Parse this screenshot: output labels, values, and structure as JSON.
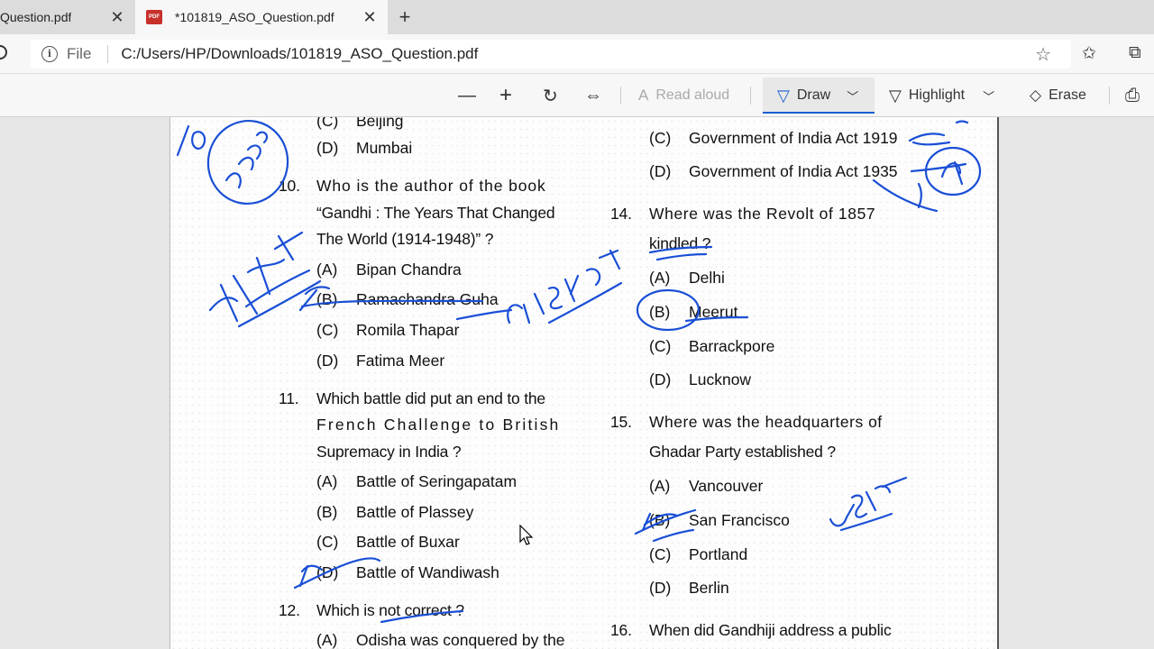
{
  "browser": {
    "tabs": [
      {
        "label": "Question.pdf",
        "active": false
      },
      {
        "label": "*101819_ASO_Question.pdf",
        "active": true
      }
    ],
    "address": {
      "scheme_label": "File",
      "url": "C:/Users/HP/Downloads/101819_ASO_Question.pdf"
    }
  },
  "toolbar": {
    "read_aloud": "Read aloud",
    "draw": "Draw",
    "highlight": "Highlight",
    "erase": "Erase"
  },
  "colors": {
    "ink": "#1a4fd6",
    "accent": "#1a5fd0"
  },
  "document": {
    "left_column": {
      "q9_tail": [
        {
          "letter": "(C)",
          "text": "Beijing"
        },
        {
          "letter": "(D)",
          "text": "Mumbai"
        }
      ],
      "q10": {
        "number": "10.",
        "lines": [
          "Who is the author of the book",
          "“Gandhi : The Years That Changed",
          "The World (1914-1948)” ?"
        ],
        "options": [
          {
            "letter": "(A)",
            "text": "Bipan Chandra"
          },
          {
            "letter": "(B)",
            "text": "Ramachandra Guha"
          },
          {
            "letter": "(C)",
            "text": "Romila Thapar"
          },
          {
            "letter": "(D)",
            "text": "Fatima Meer"
          }
        ]
      },
      "q11": {
        "number": "11.",
        "lines": [
          "Which battle did put an end to the",
          "French Challenge to British",
          "Supremacy in India ?"
        ],
        "options": [
          {
            "letter": "(A)",
            "text": "Battle of Seringapatam"
          },
          {
            "letter": "(B)",
            "text": "Battle of Plassey"
          },
          {
            "letter": "(C)",
            "text": "Battle of Buxar"
          },
          {
            "letter": "(D)",
            "text": "Battle of Wandiwash"
          }
        ]
      },
      "q12": {
        "number": "12.",
        "lines": [
          "Which is not correct ?"
        ],
        "options": [
          {
            "letter": "(A)",
            "text": "Odisha was conquered by the"
          }
        ]
      }
    },
    "right_column": {
      "q13_tail": [
        {
          "letter": "(C)",
          "text": "Government of India Act 1919"
        },
        {
          "letter": "(D)",
          "text": "Government of India Act 1935"
        }
      ],
      "q14": {
        "number": "14.",
        "lines": [
          "Where was the Revolt of 1857",
          "kindled ?"
        ],
        "options": [
          {
            "letter": "(A)",
            "text": "Delhi"
          },
          {
            "letter": "(B)",
            "text": "Meerut"
          },
          {
            "letter": "(C)",
            "text": "Barrackpore"
          },
          {
            "letter": "(D)",
            "text": "Lucknow"
          }
        ]
      },
      "q15": {
        "number": "15.",
        "lines": [
          "Where was the headquarters of",
          "Ghadar Party established ?"
        ],
        "options": [
          {
            "letter": "(A)",
            "text": "Vancouver"
          },
          {
            "letter": "(B)",
            "text": "San Francisco"
          },
          {
            "letter": "(C)",
            "text": "Portland"
          },
          {
            "letter": "(D)",
            "text": "Berlin"
          }
        ]
      },
      "q16": {
        "number": "16.",
        "lines": [
          "When did Gandhiji address a public"
        ]
      }
    }
  }
}
